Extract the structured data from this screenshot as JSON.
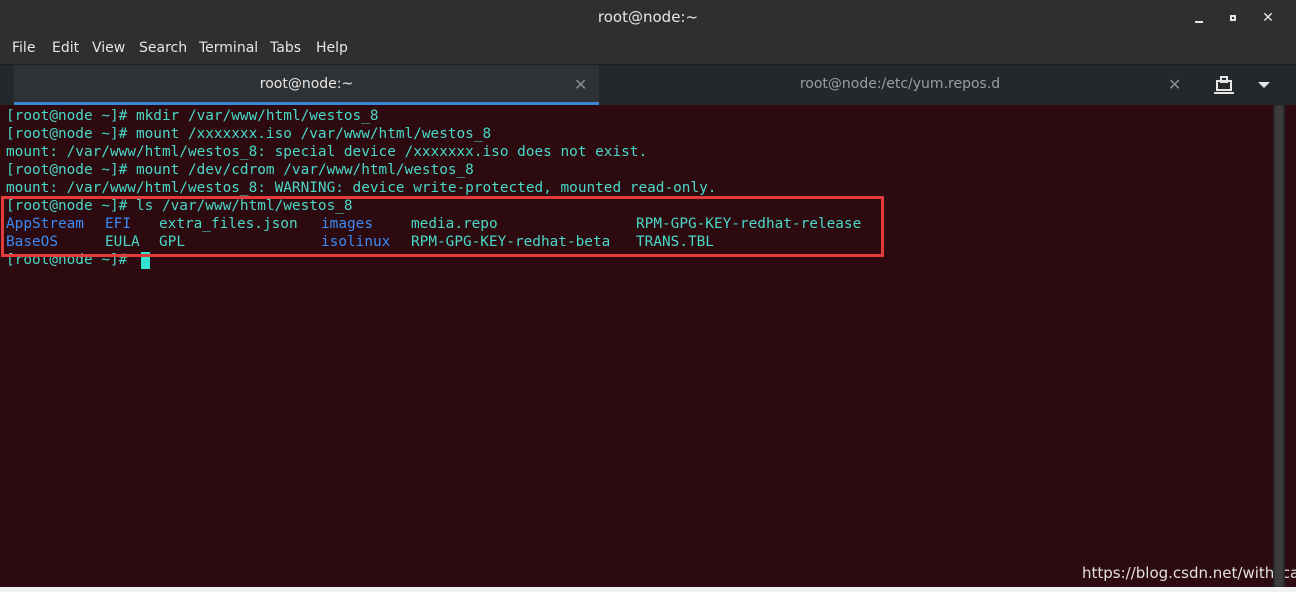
{
  "window": {
    "title": "root@node:~",
    "minimize_icon": "minimize-icon",
    "maximize_icon": "maximize-icon",
    "close_icon": "close-icon",
    "close_glyph": "✕"
  },
  "menu": [
    "File",
    "Edit",
    "View",
    "Search",
    "Terminal",
    "Tabs",
    "Help"
  ],
  "tabs": [
    {
      "label": "root@node:~",
      "active": true,
      "close": "✕"
    },
    {
      "label": "root@node:/etc/yum.repos.d",
      "active": false,
      "close": "✕"
    }
  ],
  "terminal": {
    "lines": [
      "[root@node ~]# mkdir /var/www/html/westos_8",
      "[root@node ~]# mount /xxxxxxx.iso /var/www/html/westos_8",
      "mount: /var/www/html/westos_8: special device /xxxxxxx.iso does not exist.",
      "[root@node ~]# mount /dev/cdrom /var/www/html/westos_8",
      "mount: /var/www/html/westos_8: WARNING: device write-protected, mounted read-only.",
      "[root@node ~]# ls /var/www/html/westos_8"
    ],
    "ls_output": [
      [
        "AppStream",
        "EFI",
        "extra_files.json",
        "images",
        "media.repo",
        "RPM-GPG-KEY-redhat-release"
      ],
      [
        "BaseOS",
        "EULA",
        "GPL",
        "isolinux",
        "RPM-GPG-KEY-redhat-beta",
        "TRANS.TBL"
      ]
    ],
    "prompt": "[root@node ~]# ",
    "colors": {
      "background": "#2c0a10",
      "text": "#4ad9c8",
      "directory": "#3b8bf5",
      "highlight": "#e23b3b"
    }
  },
  "watermark": "https://blog.csdn.net/with_cat"
}
